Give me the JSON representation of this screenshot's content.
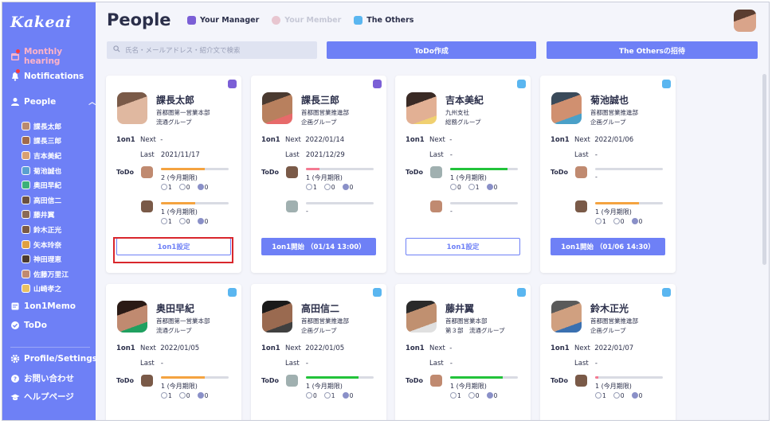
{
  "app": {
    "logo": "Kakeai"
  },
  "colors": {
    "accent": "#6e80f6",
    "manager": "#7b5fd6",
    "others": "#5ab6f0",
    "progress_orange": "#f4a340",
    "progress_green": "#22c33a",
    "progress_pink": "#f47a92"
  },
  "sidebar": {
    "nav": [
      {
        "label": "Monthly hearing",
        "icon": "calendar-icon",
        "active": true,
        "notify": true
      },
      {
        "label": "Notifications",
        "icon": "bell-icon",
        "notify": true
      },
      {
        "label": "People",
        "icon": "person-icon",
        "expanded": true
      }
    ],
    "people": [
      "課長太郎",
      "課長三郎",
      "吉本美紀",
      "菊池誠也",
      "奥田早紀",
      "高田信二",
      "藤井翼",
      "鈴木正光",
      "矢本玲奈",
      "神田理恵",
      "佐藤万里江",
      "山崎孝之"
    ],
    "nav2": [
      {
        "label": "1on1Memo",
        "icon": "memo-icon"
      },
      {
        "label": "ToDo",
        "icon": "check-circle-icon"
      }
    ],
    "nav3": [
      {
        "label": "Profile/Settings",
        "icon": "gear-icon"
      },
      {
        "label": "お問い合わせ",
        "icon": "question-icon"
      },
      {
        "label": "ヘルプページ",
        "icon": "graduation-cap-icon"
      }
    ]
  },
  "header": {
    "title": "People",
    "tabs": {
      "manager": "Your Manager",
      "member": "Your Member",
      "others": "The Others"
    },
    "search_placeholder": "氏名・メールアドレス・紹介文で検索",
    "todo_button": "ToDo作成",
    "invite_button": "The Othersの招待"
  },
  "labels": {
    "oneon1": "1on1",
    "next": "Next",
    "last": "Last",
    "todo": "ToDo"
  },
  "cards": [
    {
      "name": "課長太郎",
      "dept1": "首都圏第一営業本部",
      "dept2": "流通グループ",
      "badge": "manager",
      "next": "-",
      "last": "2021/11/17",
      "todos": [
        {
          "progress": 0.65,
          "color": "orange",
          "text": "2 (今月期限)",
          "stats": [
            "1",
            "0",
            "0"
          ]
        },
        {
          "progress": 0.5,
          "color": "orange",
          "text": "1 (今月期限)",
          "stats": [
            "1",
            "0",
            "0"
          ]
        }
      ],
      "button": "1on1設定",
      "button_style": "outline"
    },
    {
      "name": "課長三郎",
      "dept1": "首都圏営業推進部",
      "dept2": "企画グループ",
      "badge": "manager",
      "next": "2022/01/14",
      "last": "2021/12/29",
      "todos": [
        {
          "progress": 0.2,
          "color": "pink",
          "text": "1 (今月期限)",
          "stats": [
            "1",
            "0",
            "0"
          ]
        },
        {
          "progress": 0,
          "color": "orange",
          "text": "-",
          "stats": []
        }
      ],
      "button": "1on1開始 （01/14 13:00）",
      "button_style": "solid"
    },
    {
      "name": "吉本美紀",
      "dept1": "九州支社",
      "dept2": "総務グループ",
      "badge": "others",
      "next": "-",
      "last": "-",
      "todos": [
        {
          "progress": 0.85,
          "color": "green",
          "text": "1 (今月期限)",
          "stats": [
            "0",
            "1",
            "0"
          ]
        },
        {
          "progress": 0,
          "color": "orange",
          "text": "-",
          "stats": []
        }
      ],
      "button": "1on1設定",
      "button_style": "outline"
    },
    {
      "name": "菊池誠也",
      "dept1": "首都圏営業推進部",
      "dept2": "企画グループ",
      "badge": "others",
      "next": "2022/01/06",
      "last": "-",
      "todos": [
        {
          "progress": 0,
          "color": "orange",
          "text": "-",
          "stats": []
        },
        {
          "progress": 0.65,
          "color": "orange",
          "text": "1 (今月期限)",
          "stats": [
            "1",
            "0",
            "0"
          ]
        }
      ],
      "button": "1on1開始 （01/06 14:30）",
      "button_style": "solid"
    },
    {
      "name": "奥田早紀",
      "dept1": "首都圏第一営業本部",
      "dept2": "流通グループ",
      "badge": "others",
      "next": "2022/01/05",
      "last": "-",
      "todos": [
        {
          "progress": 0.65,
          "color": "orange",
          "text": "1 (今月期限)",
          "stats": [
            "1",
            "0",
            "0"
          ]
        }
      ]
    },
    {
      "name": "高田信二",
      "dept1": "首都圏営業推進部",
      "dept2": "企画グループ",
      "badge": "others",
      "next": "2022/01/05",
      "last": "-",
      "todos": [
        {
          "progress": 0.78,
          "color": "green",
          "text": "1 (今月期限)",
          "stats": [
            "0",
            "1",
            "0"
          ]
        }
      ]
    },
    {
      "name": "藤井翼",
      "dept1": "首都圏営業本部",
      "dept2": "第３部　流通グループ",
      "badge": "others",
      "next": "-",
      "last": "-",
      "todos": [
        {
          "progress": 0.78,
          "color": "green",
          "text": "1 (今月期限)",
          "stats": [
            "1",
            "0",
            "0"
          ]
        }
      ]
    },
    {
      "name": "鈴木正光",
      "dept1": "首都圏営業推進部",
      "dept2": "企画グループ",
      "badge": "others",
      "next": "2022/01/07",
      "last": "-",
      "todos": [
        {
          "progress": 0.05,
          "color": "pink",
          "text": "1 (今月期限)",
          "stats": [
            "1",
            "0",
            "0"
          ]
        }
      ]
    }
  ]
}
